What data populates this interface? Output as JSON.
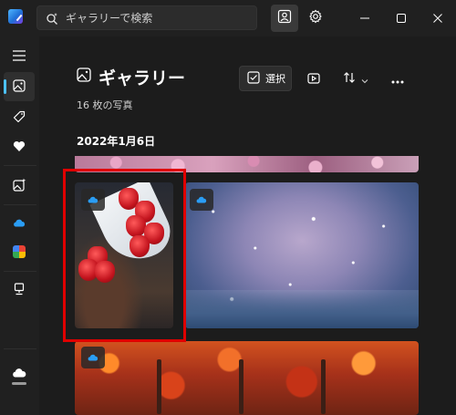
{
  "titlebar": {
    "search_placeholder": "ギャラリーで検索",
    "icons": [
      "app-logo-icon",
      "search-sparkle-icon",
      "photo-people-icon",
      "gear-icon",
      "minimize-icon",
      "maximize-icon",
      "close-icon"
    ]
  },
  "sidebar": {
    "items": [
      {
        "name": "menu",
        "icon": "hamburger-icon"
      },
      {
        "name": "gallery",
        "icon": "image-icon",
        "active": true
      },
      {
        "name": "tags",
        "icon": "tag-icon"
      },
      {
        "name": "favorites",
        "icon": "heart-icon"
      },
      {
        "name": "edit-photos",
        "icon": "image-sparkle-icon"
      },
      {
        "name": "onedrive",
        "icon": "cloud-icon"
      },
      {
        "name": "google-photos",
        "icon": "pinwheel-icon"
      },
      {
        "name": "this-pc",
        "icon": "computer-icon"
      },
      {
        "name": "onedrive-account",
        "icon": "cloud-white-icon"
      }
    ]
  },
  "main": {
    "title": "ギャラリー",
    "photo_count": "16 枚の写真",
    "toolbar": {
      "select_label": "選択",
      "icons": [
        "checkbox-icon",
        "slideshow-icon",
        "sort-icon",
        "chevron-down-icon",
        "more-icon"
      ]
    },
    "date_heading": "2022年1月6日",
    "photos": [
      {
        "subject": "cherry-blossoms",
        "onedrive_badge": false
      },
      {
        "subject": "strawberries",
        "onedrive_badge": true,
        "highlighted": true
      },
      {
        "subject": "sparkles",
        "onedrive_badge": true
      },
      {
        "subject": "autumn-forest",
        "onedrive_badge": true
      }
    ]
  },
  "colors": {
    "background": "#1c1c1c",
    "accent": "#4cc2ff",
    "highlight": "#e00000"
  }
}
